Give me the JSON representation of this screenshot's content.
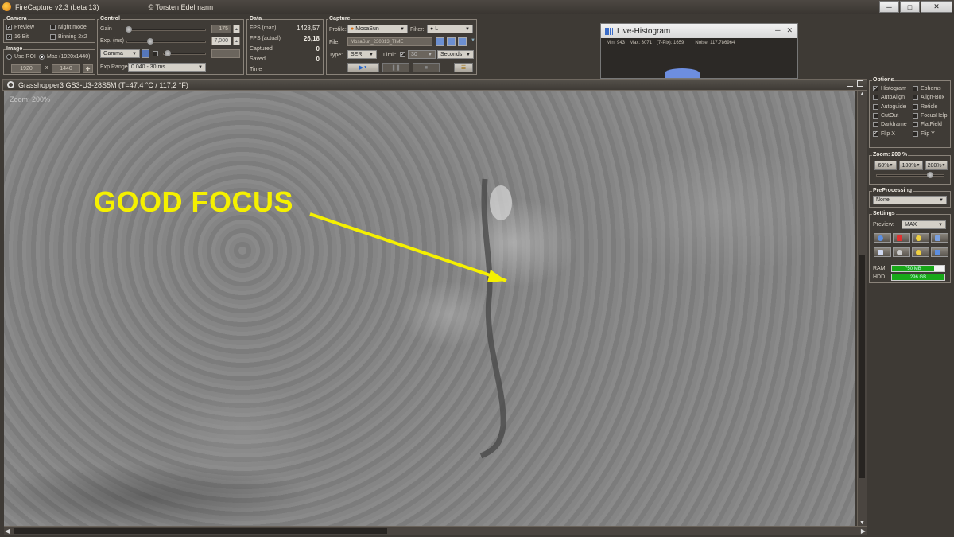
{
  "window": {
    "title": "FireCapture v2.3  (beta 13)",
    "copyright": "© Torsten Edelmann",
    "minimize": "─",
    "maximize": "□",
    "close": "✕"
  },
  "camera": {
    "title": "Camera",
    "preview": "Preview",
    "bit16": "16 Bit",
    "night_mode": "Night mode",
    "binning": "Binning 2x2"
  },
  "image_panel": {
    "title": "Image",
    "use_roi": "Use ROI",
    "max": "Max (1920x1440)",
    "width": "1920",
    "x": "x",
    "height": "1440"
  },
  "control": {
    "title": "Control",
    "gain_label": "Gain",
    "gain_value": "175",
    "gain_level": 0.02,
    "exp_label": "Exp. (ms)",
    "exp_value": "7,000",
    "exp_level": 0.3,
    "gamma_select": "Gamma",
    "gamma_level": 0.1,
    "exprange_label": "Exp.Range",
    "exprange_value": "0.040 - 30 ms"
  },
  "data": {
    "title": "Data",
    "fps_max_label": "FPS (max)",
    "fps_max": "1428,57",
    "fps_actual_label": "FPS (actual)",
    "fps_actual": "26,18",
    "captured_label": "Captured",
    "captured": "0",
    "saved_label": "Saved",
    "saved": "0",
    "time_label": "Time"
  },
  "capture": {
    "title": "Capture",
    "profile_label": "Profile:",
    "profile": "MosaSun",
    "filter_label": "Filter:",
    "filter": "L",
    "file_label": "File:",
    "file": "MosaSun_230813_TIME",
    "type_label": "Type:",
    "type": "SER",
    "limit_label": "Limit:",
    "limit_value": "30",
    "limit_unit": "Seconds"
  },
  "histogram": {
    "title": "Live-Histogram",
    "min": "Min: 943",
    "max": "Max: 3071",
    "peak": "(7-Pix): 1659",
    "noise": "Noise: 117.786964",
    "minimize": "─",
    "close": "✕"
  },
  "view": {
    "title": "Grasshopper3 GS3-U3-28S5M  (T=47,4 °C / 117,2 °F)",
    "zoom_label": "Zoom: 200%",
    "annotation": "GOOD FOCUS"
  },
  "options": {
    "title": "Options",
    "items": [
      {
        "label": "Histogram",
        "checked": true
      },
      {
        "label": "Ephems",
        "checked": false
      },
      {
        "label": "AutoAlign",
        "checked": false
      },
      {
        "label": "Align-Box",
        "checked": false
      },
      {
        "label": "Autoguide",
        "checked": false
      },
      {
        "label": "Reticle",
        "checked": false
      },
      {
        "label": "CutOut",
        "checked": false
      },
      {
        "label": "FocusHelp",
        "checked": false
      },
      {
        "label": "Darkframe",
        "checked": false
      },
      {
        "label": "FlatField",
        "checked": false
      },
      {
        "label": "Flip X",
        "checked": true
      },
      {
        "label": "Flip Y",
        "checked": false
      }
    ]
  },
  "zoom": {
    "title": "Zoom: 200 %",
    "b1": "60%",
    "b2": "100%",
    "b3": "200%",
    "level": 0.8
  },
  "preprocessing": {
    "title": "PreProcessing",
    "value": "None"
  },
  "settings": {
    "title": "Settings",
    "preview_label": "Preview:",
    "preview_value": "MAX",
    "ram_label": "RAM",
    "ram_value": "750 MB",
    "ram_level": 0.8,
    "hdd_label": "HDD",
    "hdd_value": "296 GB",
    "hdd_level": 1.0
  },
  "colors": {
    "accent_green": "#18a818",
    "annotation_yellow": "#f5f000",
    "histogram_blue": "#6d8ee0"
  }
}
